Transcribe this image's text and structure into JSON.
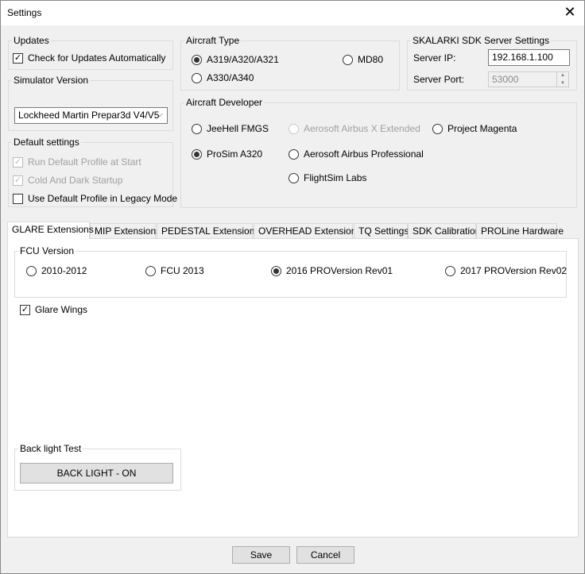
{
  "window": {
    "title": "Settings"
  },
  "updates": {
    "label": "Updates",
    "check_label": "Check for Updates Automatically"
  },
  "simulator": {
    "label": "Simulator Version",
    "selected": "Lockheed Martin Prepar3d V4/V5"
  },
  "defaults": {
    "label": "Default settings",
    "run_profile": "Run Default Profile at Start",
    "cold_dark": "Cold And Dark Startup",
    "legacy": "Use Default Profile in Legacy Mode"
  },
  "aircraft_type": {
    "label": "Aircraft Type",
    "a319": "A319/A320/A321",
    "a330": "A330/A340",
    "md80": "MD80"
  },
  "sdk": {
    "label": "SKALARKI SDK Server Settings",
    "ip_label": "Server IP:",
    "ip_value": "192.168.1.100",
    "port_label": "Server Port:",
    "port_value": "53000"
  },
  "developer": {
    "label": "Aircraft Developer",
    "jeehell": "JeeHell FMGS",
    "prosim": "ProSim A320",
    "aerosoft_x": "Aerosoft Airbus X Extended",
    "aerosoft_pro": "Aerosoft Airbus Professional",
    "flightsim": "FlightSim Labs",
    "magenta": "Project Magenta"
  },
  "tabs": {
    "glare": "GLARE Extensions",
    "mip": "MIP Extensions",
    "pedestal": "PEDESTAL Extensions",
    "overhead": "OVERHEAD Extensions",
    "tq": "TQ Settings",
    "sdk": "SDK Calibration",
    "proline": "PROLine Hardware"
  },
  "fcu": {
    "label": "FCU Version",
    "v2010": "2010-2012",
    "v2013": "FCU 2013",
    "v2016": "2016 PROVersion Rev01",
    "v2017": "2017 PROVersion Rev02"
  },
  "glare_wings": "Glare Wings",
  "backlight": {
    "label": "Back light Test",
    "button": "BACK LIGHT - ON"
  },
  "footer": {
    "save": "Save",
    "cancel": "Cancel"
  }
}
